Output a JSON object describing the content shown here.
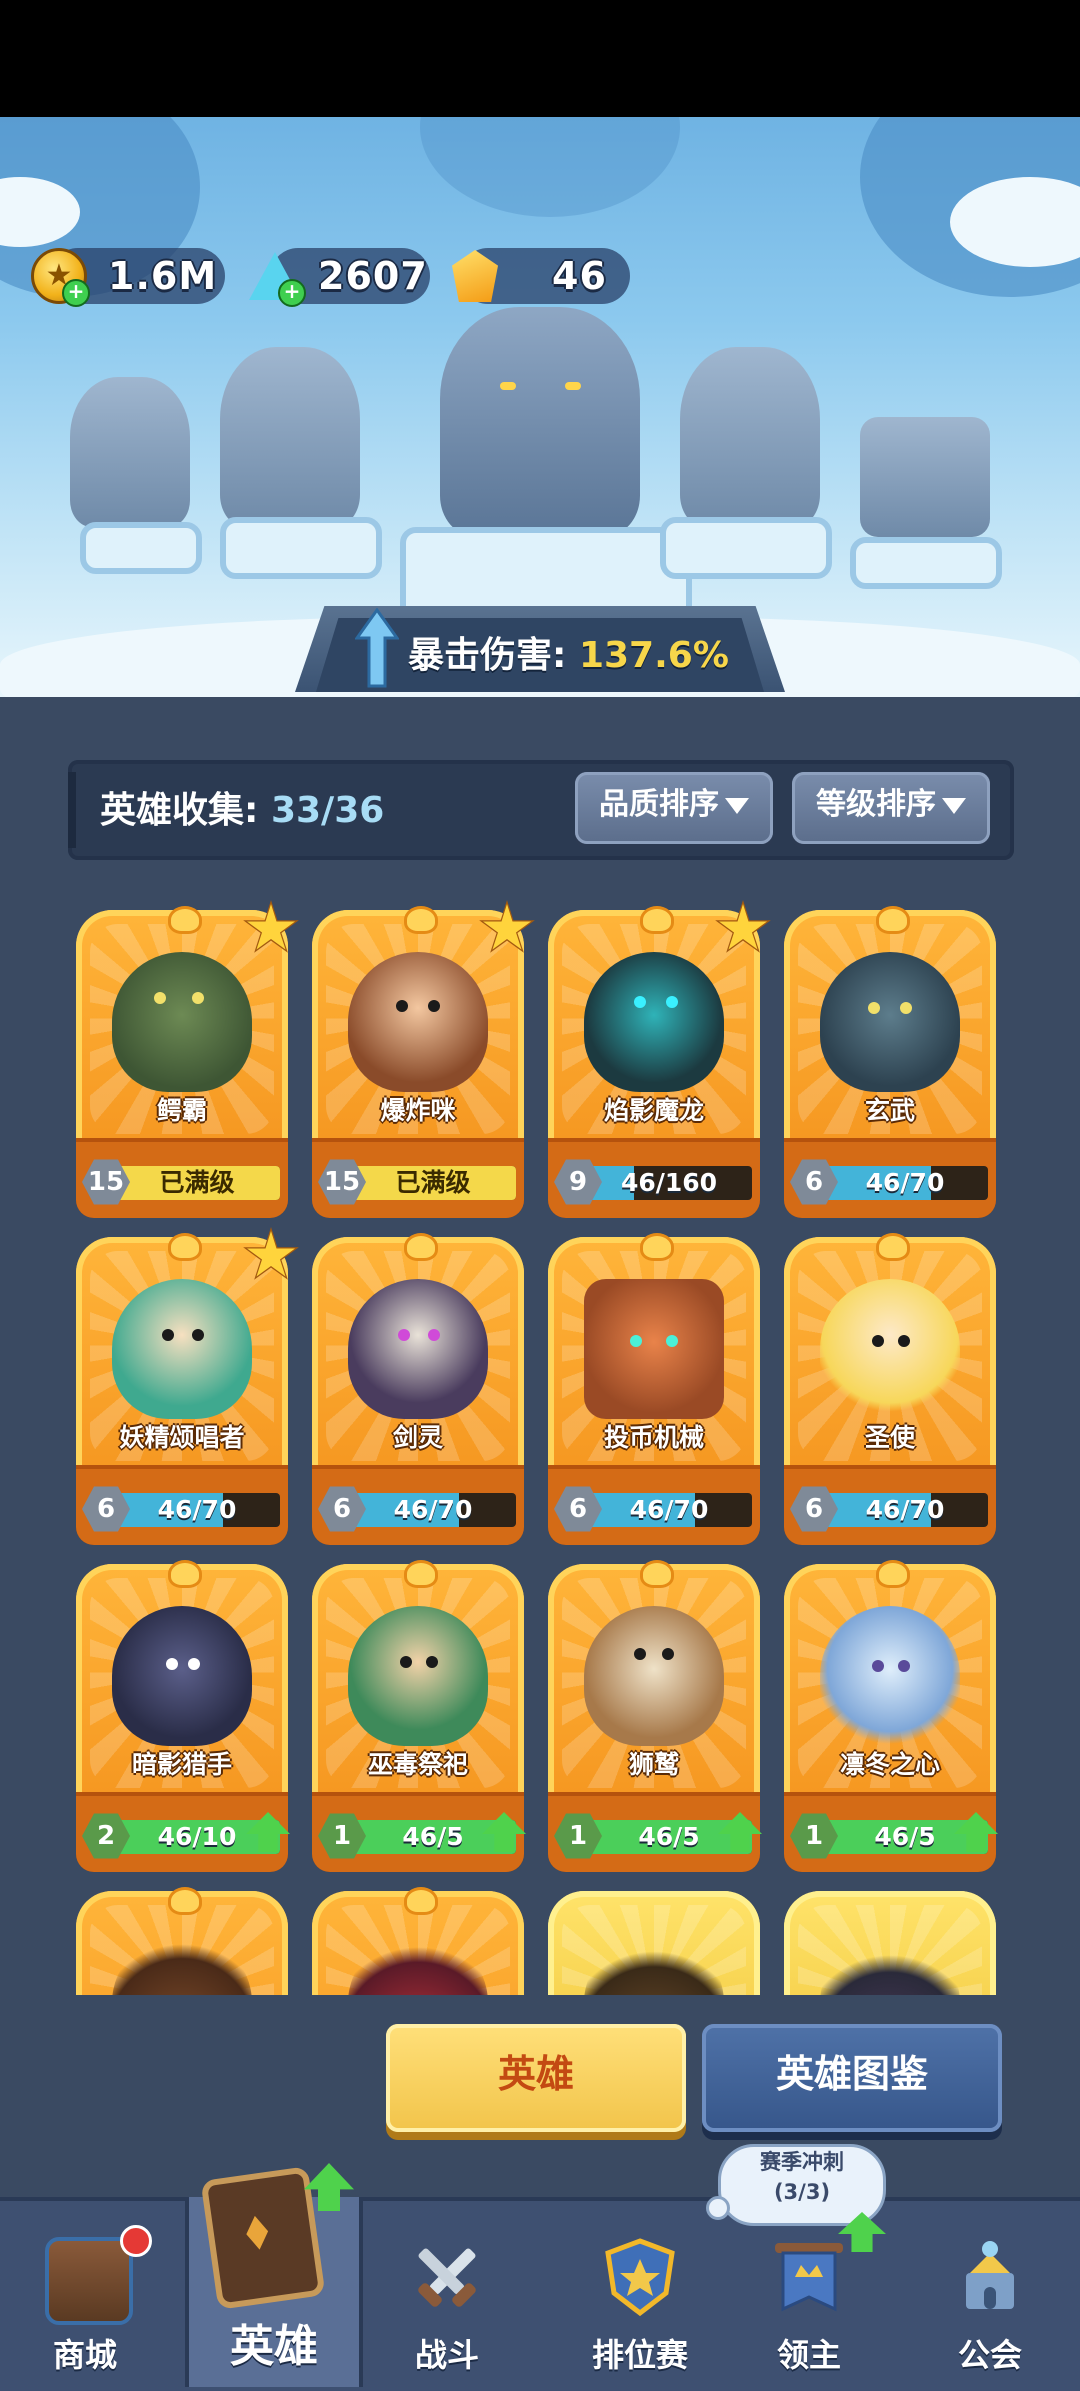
{
  "currencies": {
    "gold": "1.6M",
    "crystal": "2607",
    "gem": "46"
  },
  "crit": {
    "label": "暴击伤害:",
    "value": "137.6%"
  },
  "collection": {
    "label": "英雄收集:",
    "count": "33/36"
  },
  "sort": {
    "quality": "品质排序",
    "level": "等级排序"
  },
  "heroes": [
    {
      "name": "鳄霸",
      "level": "15",
      "progress": "已满级",
      "fill": 1.0,
      "star": true
    },
    {
      "name": "爆炸咪",
      "level": "15",
      "progress": "已满级",
      "fill": 1.0,
      "star": true
    },
    {
      "name": "焰影魔龙",
      "level": "9",
      "progress": "46/160",
      "fill": 0.2875,
      "star": true
    },
    {
      "name": "玄武",
      "level": "6",
      "progress": "46/70",
      "fill": 0.657,
      "star": false
    },
    {
      "name": "妖精颂唱者",
      "level": "6",
      "progress": "46/70",
      "fill": 0.657,
      "star": true
    },
    {
      "name": "剑灵",
      "level": "6",
      "progress": "46/70",
      "fill": 0.657,
      "star": false
    },
    {
      "name": "投币机械",
      "level": "6",
      "progress": "46/70",
      "fill": 0.657,
      "star": false
    },
    {
      "name": "圣使",
      "level": "6",
      "progress": "46/70",
      "fill": 0.657,
      "star": false
    },
    {
      "name": "暗影猎手",
      "level": "2",
      "progress": "46/10",
      "fill": 1.0,
      "star": false,
      "upgrade": true
    },
    {
      "name": "巫毒祭祀",
      "level": "1",
      "progress": "46/5",
      "fill": 1.0,
      "star": false,
      "upgrade": true
    },
    {
      "name": "狮鹫",
      "level": "1",
      "progress": "46/5",
      "fill": 1.0,
      "star": false,
      "upgrade": true
    },
    {
      "name": "凛冬之心",
      "level": "1",
      "progress": "46/5",
      "fill": 1.0,
      "star": false,
      "upgrade": true
    }
  ],
  "buttons": {
    "hero": "英雄",
    "codex": "英雄图鉴"
  },
  "season_bubble": {
    "title": "赛季冲刺",
    "progress": "(3/3)"
  },
  "tabs": [
    {
      "label": "商城"
    },
    {
      "label": "英雄"
    },
    {
      "label": "战斗"
    },
    {
      "label": "排位赛"
    },
    {
      "label": "领主"
    },
    {
      "label": "公会"
    }
  ],
  "colors": {
    "panel": "#3a4a62",
    "card_orange": "#f7a22a",
    "progress_blue": "#43b4d9",
    "progress_green": "#4bcf5a",
    "progress_max": "#f4d84a",
    "crit_value": "#f7d64a"
  }
}
